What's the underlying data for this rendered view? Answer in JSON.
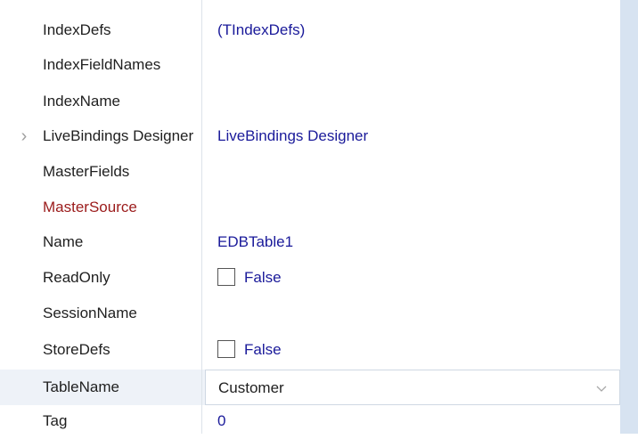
{
  "properties": [
    {
      "name": "IndexDefs",
      "value": "(TIndexDefs)",
      "name_style": "normal",
      "value_style": "link"
    },
    {
      "name": "IndexFieldNames",
      "value": "",
      "name_style": "normal",
      "value_style": "link"
    },
    {
      "name": "IndexName",
      "value": "",
      "name_style": "normal",
      "value_style": "link"
    },
    {
      "name": "LiveBindings Designer",
      "value": "LiveBindings Designer",
      "name_style": "normal",
      "value_style": "link",
      "expandable": true
    },
    {
      "name": "MasterFields",
      "value": "",
      "name_style": "normal",
      "value_style": "link"
    },
    {
      "name": "MasterSource",
      "value": "",
      "name_style": "red",
      "value_style": "link"
    },
    {
      "name": "Name",
      "value": "EDBTable1",
      "name_style": "normal",
      "value_style": "link"
    },
    {
      "name": "ReadOnly",
      "value": "False",
      "name_style": "normal",
      "value_style": "checkbox"
    },
    {
      "name": "SessionName",
      "value": "",
      "name_style": "normal",
      "value_style": "link"
    },
    {
      "name": "StoreDefs",
      "value": "False",
      "name_style": "normal",
      "value_style": "checkbox"
    },
    {
      "name": "TableName",
      "value": "Customer",
      "name_style": "normal",
      "value_style": "combo",
      "selected": true
    },
    {
      "name": "Tag",
      "value": "0",
      "name_style": "normal",
      "value_style": "link"
    }
  ],
  "icons": {
    "expander": "chevron-right-icon",
    "combo": "chevron-down-icon"
  },
  "colors": {
    "selected_row": "#eef2f8",
    "link_value": "#1a1a9a",
    "red_name": "#9b1b1b",
    "scroll_bar": "#d7e3f1"
  }
}
